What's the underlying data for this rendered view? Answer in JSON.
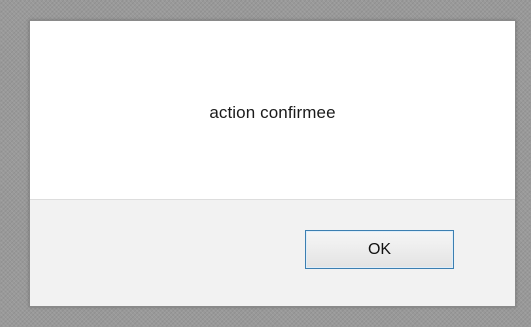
{
  "dialog": {
    "message": "action confirmee",
    "ok_label": "OK"
  }
}
